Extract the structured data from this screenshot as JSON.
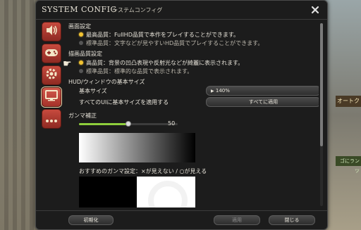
{
  "window": {
    "title": "SYSTEM CONFIG",
    "subtitle": "システムコンフィグ",
    "close_icon": "close-icon"
  },
  "sidebar": {
    "items": [
      {
        "name": "sound",
        "icon": "speaker-icon",
        "active": false
      },
      {
        "name": "input",
        "icon": "gamepad-icon",
        "active": false
      },
      {
        "name": "graphics",
        "icon": "gear-icon",
        "active": false
      },
      {
        "name": "display",
        "icon": "monitor-icon",
        "active": true
      },
      {
        "name": "other",
        "icon": "ellipsis-icon",
        "active": false
      }
    ]
  },
  "screen_quality": {
    "heading": "画面設定",
    "options": [
      {
        "label": "最高品質：FullHD品質で本作をプレイすることができます。",
        "selected": true
      },
      {
        "label": "標準品質：文字などが見やすいHD品質でプレイすることができます。",
        "selected": false
      }
    ]
  },
  "render_quality": {
    "heading": "描画品質設定",
    "options": [
      {
        "label": "高品質：背景の凹凸表現や反射光などが綺麗に表示されます。",
        "selected": true
      },
      {
        "label": "標準品質：標準的な品質で表示されます。",
        "selected": false
      }
    ]
  },
  "hud": {
    "heading": "HUD/ウィンドウの基本サイズ",
    "base_size_label": "基本サイズ",
    "base_size_value": "140%",
    "apply_all_label": "すべてのUIに基本サイズを適用する",
    "apply_all_button": "すべてに適用"
  },
  "gamma": {
    "heading": "ガンマ補正",
    "value_text": "50",
    "value_fraction": 0.5,
    "recommend_text": "おすすめのガンマ設定：×が見えない / ○が見える"
  },
  "footer": {
    "reset_button": "初期化",
    "apply_button": "適用",
    "close_button": "閉じる"
  },
  "background": {
    "sign_text": "オートク",
    "sign2_text": "ゴにランツ"
  },
  "colors": {
    "accent": "#f1c232",
    "slider_fill": "#8fcf3c",
    "sidebar_red": "#c74a3e"
  }
}
